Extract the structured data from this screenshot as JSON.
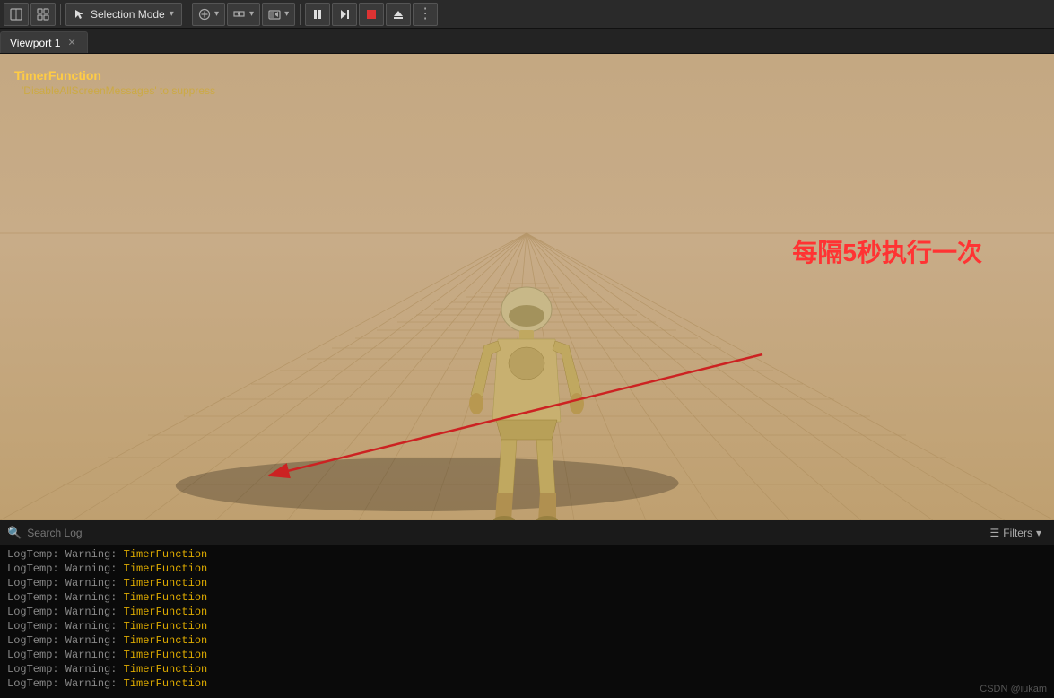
{
  "toolbar": {
    "selection_mode_label": "Selection Mode",
    "chevron": "▾",
    "buttons": [
      "⊕",
      "⊞",
      "⊡",
      "⊟",
      "⋮"
    ]
  },
  "tabs": [
    {
      "label": "Viewport 1",
      "active": true
    }
  ],
  "viewport": {
    "overlay_text": "TimerFunction",
    "suppress_text": "'DisableAllScreenMessages' to suppress",
    "chinese_annotation": "每隔5秒执行一次"
  },
  "log_panel": {
    "search_placeholder": "Search Log",
    "filters_label": "Filters",
    "log_lines": [
      {
        "prefix": "LogTemp: Warning: ",
        "func": "TimerFunction"
      },
      {
        "prefix": "LogTemp: Warning: ",
        "func": "TimerFunction"
      },
      {
        "prefix": "LogTemp: Warning: ",
        "func": "TimerFunction"
      },
      {
        "prefix": "LogTemp: Warning: ",
        "func": "TimerFunction"
      },
      {
        "prefix": "LogTemp: Warning: ",
        "func": "TimerFunction"
      },
      {
        "prefix": "LogTemp: Warning: ",
        "func": "TimerFunction"
      },
      {
        "prefix": "LogTemp: Warning: ",
        "func": "TimerFunction"
      },
      {
        "prefix": "LogTemp: Warning: ",
        "func": "TimerFunction"
      },
      {
        "prefix": "LogTemp: Warning: ",
        "func": "TimerFunction"
      },
      {
        "prefix": "LogTemp: Warning: ",
        "func": "TimerFunction"
      }
    ]
  },
  "credit": "CSDN @iukam"
}
